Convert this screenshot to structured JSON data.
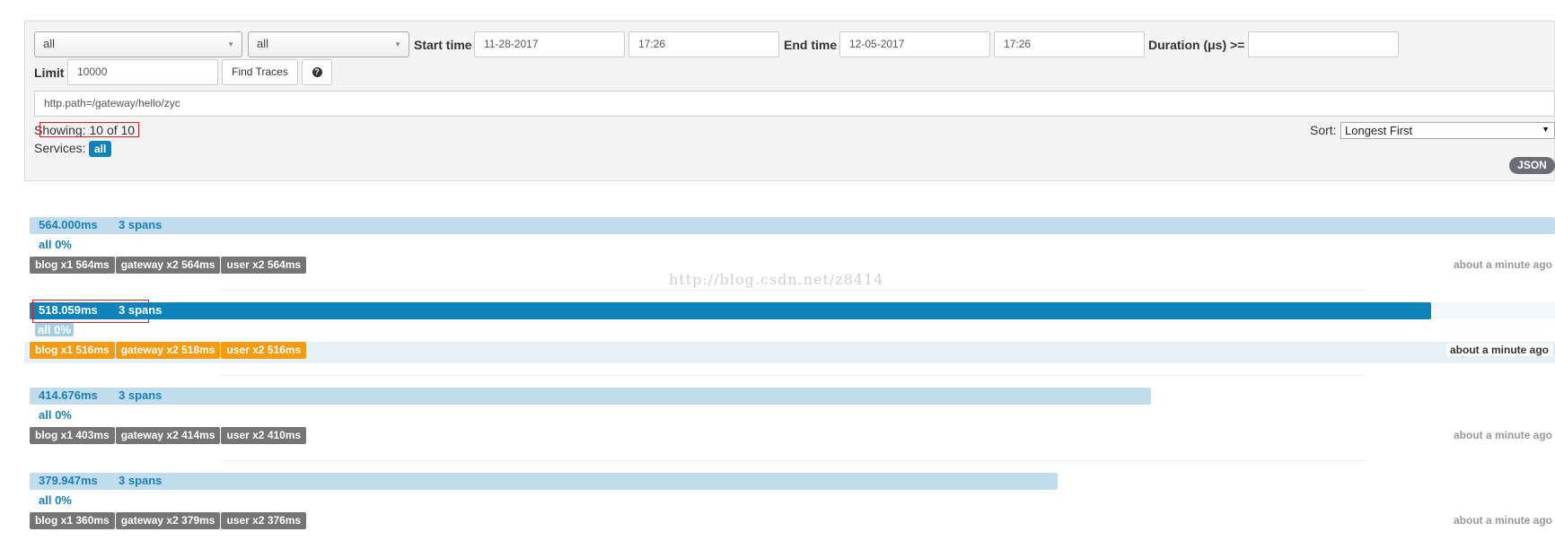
{
  "search": {
    "service_select": "all",
    "span_select": "all",
    "start_time_label": "Start time",
    "start_date": "11-28-2017",
    "start_time": "17:26",
    "end_time_label": "End time",
    "end_date": "12-05-2017",
    "end_time": "17:26",
    "duration_label": "Duration (μs) >=",
    "duration_value": "",
    "limit_label": "Limit",
    "limit_value": "10000",
    "find_button": "Find Traces",
    "help_icon": "?",
    "annotation_query": "http.path=/gateway/hello/zyc"
  },
  "results": {
    "showing": "Showing: 10 of 10",
    "services_label": "Services:",
    "service_badge": "all",
    "sort_label": "Sort:",
    "sort_value": "Longest First",
    "json_button": "JSON"
  },
  "watermark": "http://blog.csdn.net/z8414",
  "colors": {
    "accent": "#0e83b9",
    "bar_light": "#c0dced",
    "tag_gray": "#757575",
    "tag_orange": "#f39c12"
  },
  "traces": [
    {
      "duration": "564.000ms",
      "spans": "3 spans",
      "pct": "all 0%",
      "bar_fraction": 1.0,
      "selected": false,
      "tags": [
        "blog x1 564ms",
        "gateway x2 564ms",
        "user x2 564ms"
      ],
      "ago": "about a minute ago"
    },
    {
      "duration": "518.059ms",
      "spans": "3 spans",
      "pct": "all 0%",
      "bar_fraction": 0.9185,
      "selected": true,
      "tags": [
        "blog x1 516ms",
        "gateway x2 518ms",
        "user x2 516ms"
      ],
      "ago": "about a minute ago"
    },
    {
      "duration": "414.676ms",
      "spans": "3 spans",
      "pct": "all 0%",
      "bar_fraction": 0.7352,
      "selected": false,
      "tags": [
        "blog x1 403ms",
        "gateway x2 414ms",
        "user x2 410ms"
      ],
      "ago": "about a minute ago"
    },
    {
      "duration": "379.947ms",
      "spans": "3 spans",
      "pct": "all 0%",
      "bar_fraction": 0.6737,
      "selected": false,
      "tags": [
        "blog x1 360ms",
        "gateway x2 379ms",
        "user x2 376ms"
      ],
      "ago": "about a minute ago"
    }
  ]
}
